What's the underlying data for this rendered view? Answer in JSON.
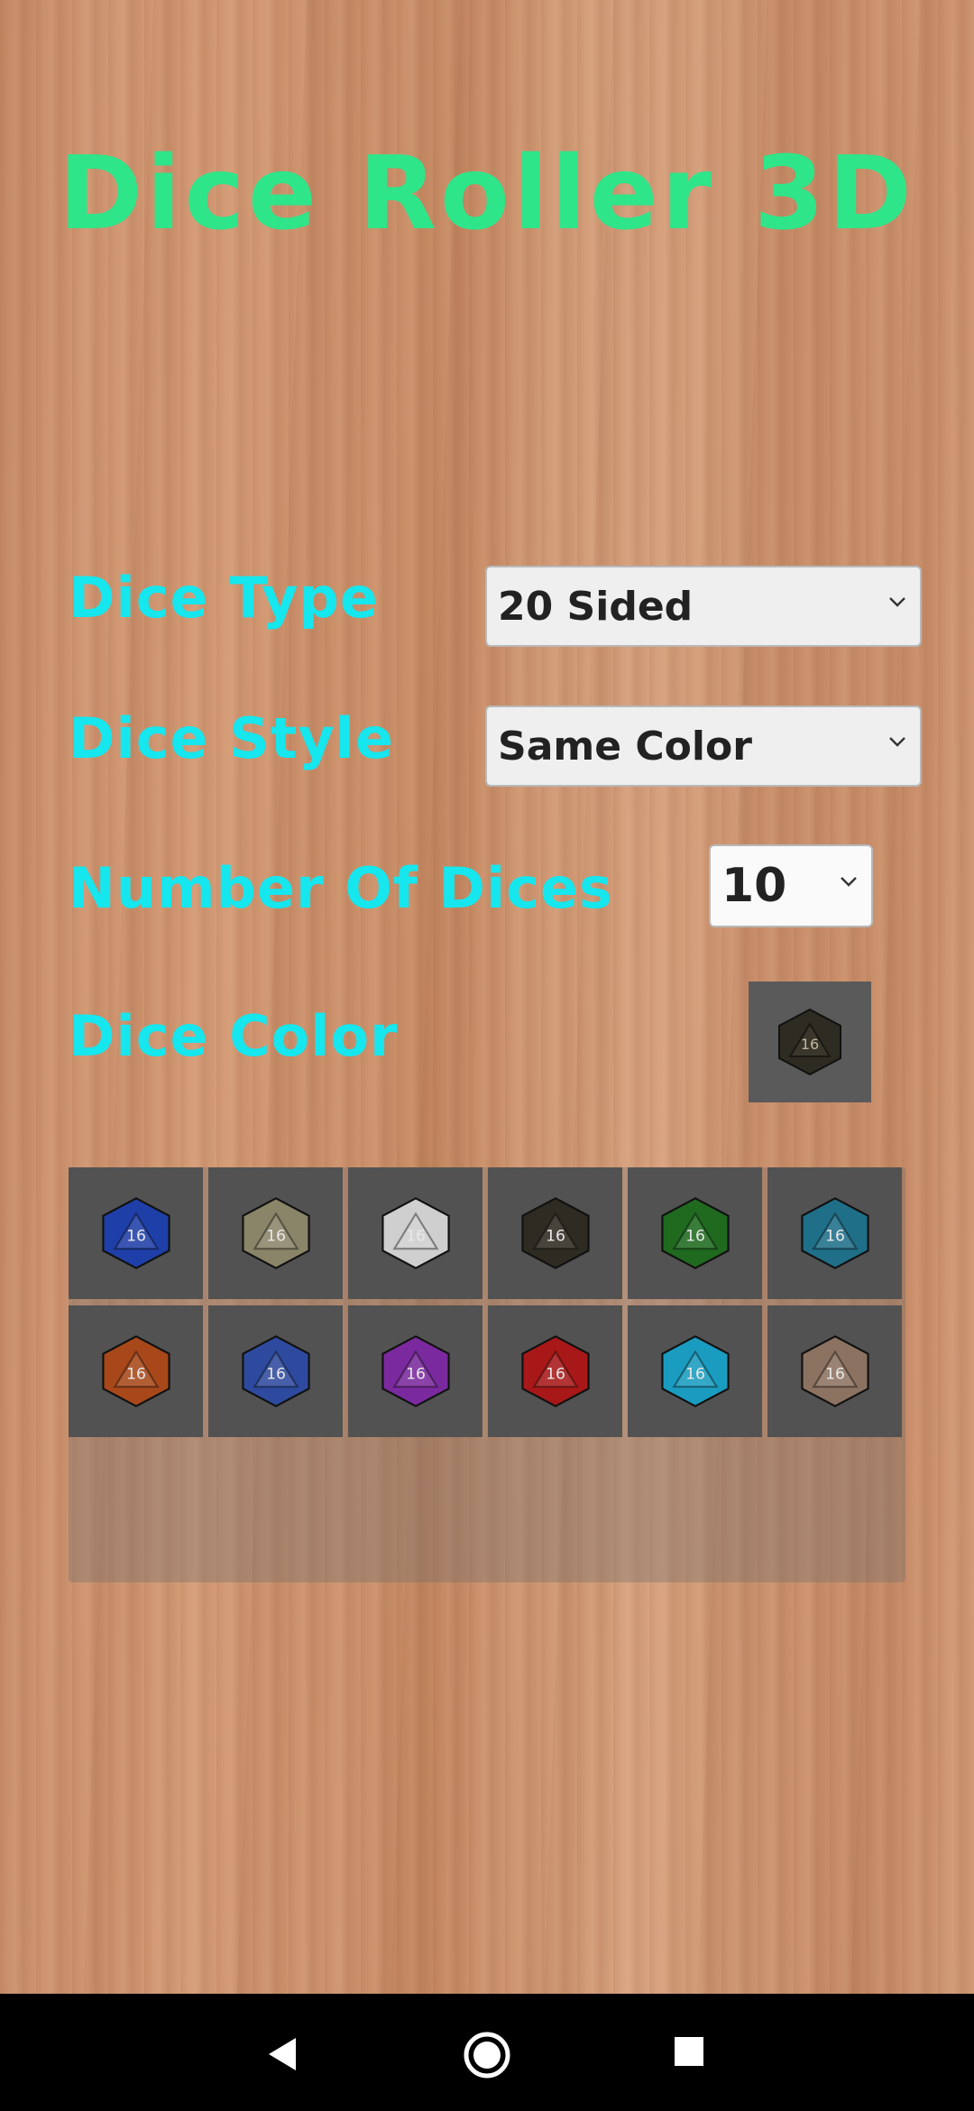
{
  "app": {
    "title": "Dice Roller 3D"
  },
  "settings": {
    "dice_type": {
      "label": "Dice Type",
      "value": "20 Sided"
    },
    "dice_style": {
      "label": "Dice Style",
      "value": "Same Color"
    },
    "number_of_dices": {
      "label": "Number Of Dices",
      "value": "10"
    },
    "dice_color": {
      "label": "Dice Color",
      "selected": "black"
    }
  },
  "palette": [
    {
      "name": "blue",
      "color": "#1f3fa8"
    },
    {
      "name": "beige",
      "color": "#8a8468"
    },
    {
      "name": "white",
      "color": "#cfcfcf"
    },
    {
      "name": "black",
      "color": "#2e2b22"
    },
    {
      "name": "green",
      "color": "#1f6a1f"
    },
    {
      "name": "teal",
      "color": "#1f6f88"
    },
    {
      "name": "orange",
      "color": "#a8481a"
    },
    {
      "name": "navy",
      "color": "#2e4a9e"
    },
    {
      "name": "purple",
      "color": "#7a2a9e"
    },
    {
      "name": "red",
      "color": "#a81818"
    },
    {
      "name": "cyan",
      "color": "#1a9cc0"
    },
    {
      "name": "tan",
      "color": "#8c7260"
    }
  ],
  "colors": {
    "title": "#2fe58a",
    "label": "#16e6ee"
  }
}
